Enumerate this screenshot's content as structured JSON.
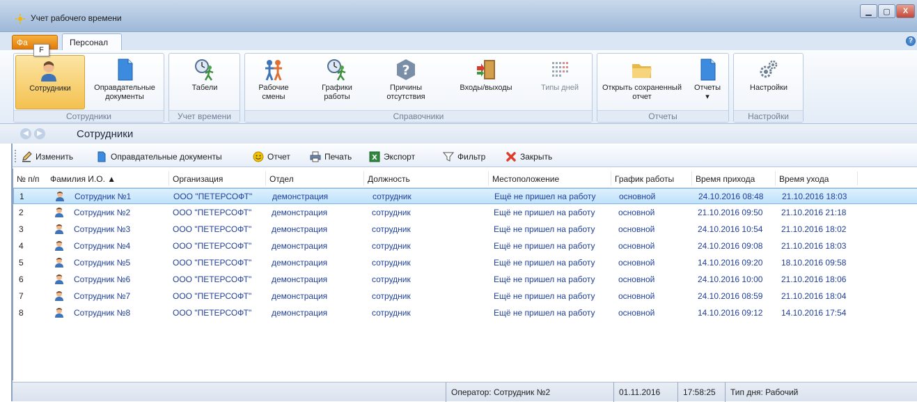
{
  "window": {
    "title": "Учет рабочего времени",
    "min_label": "▁",
    "max_label": "▢",
    "close_label": "X"
  },
  "ribbon_tabs": {
    "file": "Фа",
    "file_keytip": "F",
    "personnel": "Персонал",
    "help": "?"
  },
  "ribbon": {
    "groups": [
      {
        "label": "Сотрудники",
        "buttons": [
          {
            "label": "Сотрудники",
            "icon": "employee-icon",
            "active": true
          },
          {
            "label": "Оправдательные документы",
            "icon": "document-icon"
          }
        ]
      },
      {
        "label": "Учет времени",
        "buttons": [
          {
            "label": "Табели",
            "icon": "clock-runner-icon"
          }
        ]
      },
      {
        "label": "Справочники",
        "buttons": [
          {
            "label": "Рабочие смены",
            "icon": "people-icon"
          },
          {
            "label": "Графики работы",
            "icon": "clock-runner-icon"
          },
          {
            "label": "Причины отсутствия",
            "icon": "question-icon"
          },
          {
            "label": "Входы/выходы",
            "icon": "door-icon"
          },
          {
            "label": "Типы дней",
            "icon": "calendar-grid-icon",
            "disabled": true
          }
        ]
      },
      {
        "label": "Отчеты",
        "buttons": [
          {
            "label": "Открыть сохраненный отчет",
            "icon": "folder-icon"
          },
          {
            "label": "Отчеты",
            "icon": "document-icon",
            "dropdown": "▾"
          }
        ]
      },
      {
        "label": "Настройки",
        "buttons": [
          {
            "label": "Настройки",
            "icon": "gears-icon"
          }
        ]
      }
    ]
  },
  "navigation": {
    "back": "◀",
    "forward": "▶",
    "breadcrumb": "Сотрудники"
  },
  "toolbar": {
    "edit": "Изменить",
    "documents": "Оправдательные документы",
    "report": "Отчет",
    "print": "Печать",
    "export": "Экспорт",
    "filter": "Фильтр",
    "close": "Закрыть"
  },
  "grid": {
    "columns": [
      "№ п/п",
      "Фамилия И.О. ▲",
      "Организация",
      "Отдел",
      "Должность",
      "Местоположение",
      "График работы",
      "Время прихода",
      "Время ухода"
    ],
    "rows": [
      {
        "n": "1",
        "name": "Сотрудник №1",
        "org": "ООО \"ПЕТЕРСОФТ\"",
        "dept": "демонстрация",
        "pos": "сотрудник",
        "loc": "Ещё не пришел на работу",
        "sched": "основной",
        "in": "24.10.2016 08:48",
        "out": "21.10.2016 18:03"
      },
      {
        "n": "2",
        "name": "Сотрудник №2",
        "org": "ООО \"ПЕТЕРСОФТ\"",
        "dept": "демонстрация",
        "pos": "сотрудник",
        "loc": "Ещё не пришел на работу",
        "sched": "основной",
        "in": "21.10.2016 09:50",
        "out": "21.10.2016 21:18"
      },
      {
        "n": "3",
        "name": "Сотрудник №3",
        "org": "ООО \"ПЕТЕРСОФТ\"",
        "dept": "демонстрация",
        "pos": "сотрудник",
        "loc": "Ещё не пришел на работу",
        "sched": "основной",
        "in": "24.10.2016 10:54",
        "out": "21.10.2016 18:02"
      },
      {
        "n": "4",
        "name": "Сотрудник №4",
        "org": "ООО \"ПЕТЕРСОФТ\"",
        "dept": "демонстрация",
        "pos": "сотрудник",
        "loc": "Ещё не пришел на работу",
        "sched": "основной",
        "in": "24.10.2016 09:08",
        "out": "21.10.2016 18:03"
      },
      {
        "n": "5",
        "name": "Сотрудник №5",
        "org": "ООО \"ПЕТЕРСОФТ\"",
        "dept": "демонстрация",
        "pos": "сотрудник",
        "loc": "Ещё не пришел на работу",
        "sched": "основной",
        "in": "14.10.2016 09:20",
        "out": "18.10.2016 09:58"
      },
      {
        "n": "6",
        "name": "Сотрудник №6",
        "org": "ООО \"ПЕТЕРСОФТ\"",
        "dept": "демонстрация",
        "pos": "сотрудник",
        "loc": "Ещё не пришел на работу",
        "sched": "основной",
        "in": "24.10.2016 10:00",
        "out": "21.10.2016 18:06"
      },
      {
        "n": "7",
        "name": "Сотрудник №7",
        "org": "ООО \"ПЕТЕРСОФТ\"",
        "dept": "демонстрация",
        "pos": "сотрудник",
        "loc": "Ещё не пришел на работу",
        "sched": "основной",
        "in": "24.10.2016 08:59",
        "out": "21.10.2016 18:04"
      },
      {
        "n": "8",
        "name": "Сотрудник №8",
        "org": "ООО \"ПЕТЕРСОФТ\"",
        "dept": "демонстрация",
        "pos": "сотрудник",
        "loc": "Ещё не пришел на работу",
        "sched": "основной",
        "in": "14.10.2016 09:12",
        "out": "14.10.2016 17:54"
      }
    ]
  },
  "statusbar": {
    "operator": "Оператор:  Сотрудник №2",
    "date": "01.11.2016",
    "time": "17:58:25",
    "day_type": "Тип дня:  Рабочий"
  },
  "colors": {
    "accent_orange": "#e27b08",
    "link_blue": "#1f3f9a",
    "selection": "#bfe2fb"
  }
}
